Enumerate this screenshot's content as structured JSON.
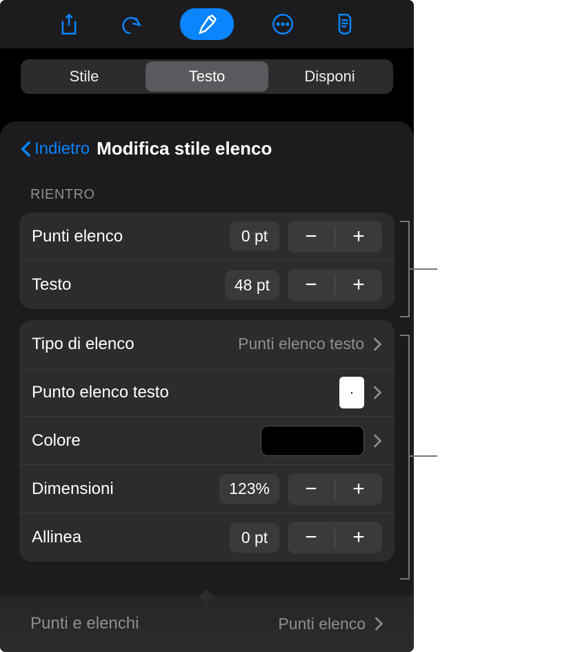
{
  "segments": {
    "style": "Stile",
    "text": "Testo",
    "arrange": "Disponi"
  },
  "nav": {
    "back": "Indietro",
    "title": "Modifica stile elenco"
  },
  "sections": {
    "indent_header": "RIENTRO"
  },
  "indent": {
    "bullets_label": "Punti elenco",
    "bullets_value": "0 pt",
    "text_label": "Testo",
    "text_value": "48 pt"
  },
  "list": {
    "type_label": "Tipo di elenco",
    "type_value": "Punti elenco testo",
    "bullet_text_label": "Punto elenco testo",
    "bullet_glyph": "·",
    "color_label": "Colore",
    "color_value": "#000000",
    "size_label": "Dimensioni",
    "size_value": "123%",
    "align_label": "Allinea",
    "align_value": "0 pt"
  },
  "toast": {
    "title": "Punti e elenchi",
    "value": "Punti elenco"
  },
  "glyphs": {
    "minus": "−",
    "plus": "+"
  }
}
